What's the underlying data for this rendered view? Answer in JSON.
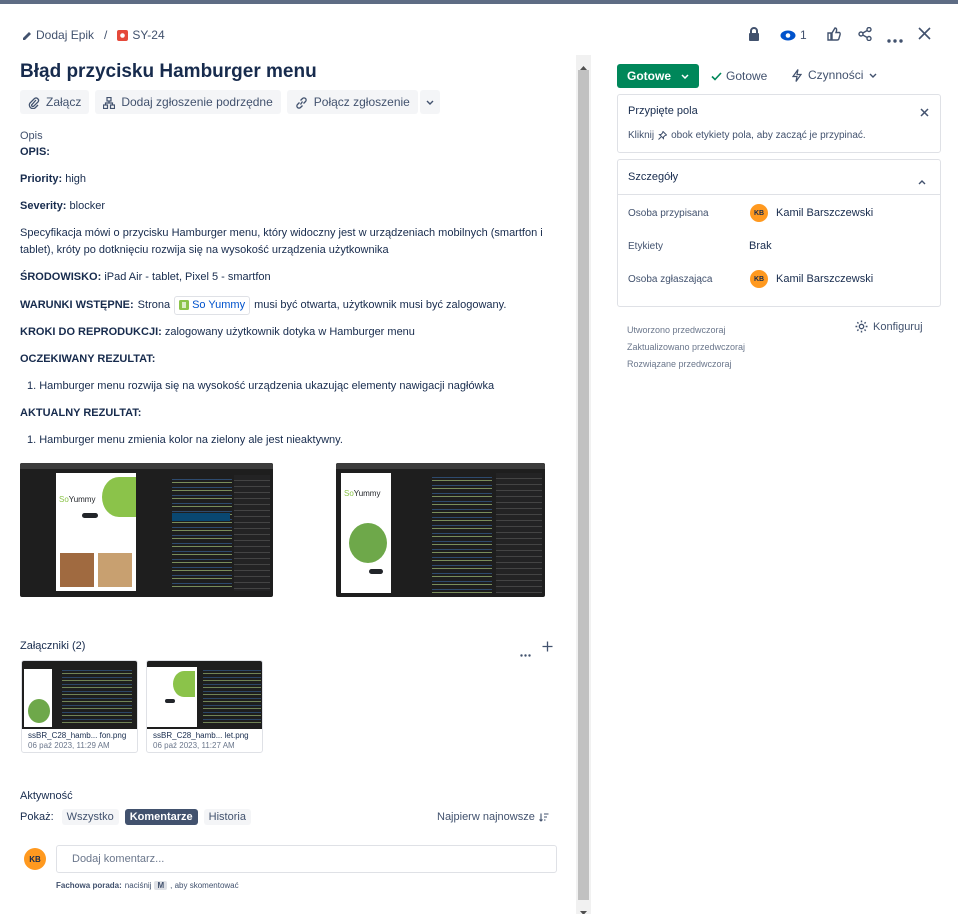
{
  "breadcrumb": {
    "epic_label": "Dodaj Epik",
    "separator": "/",
    "issue_key": "SY-24"
  },
  "header_actions": {
    "watch_count": "1"
  },
  "issue": {
    "title": "Błąd przycisku Hamburger menu"
  },
  "toolbar": {
    "attach": "Załącz",
    "add_child": "Dodaj zgłoszenie podrzędne",
    "link_issue": "Połącz zgłoszenie"
  },
  "description": {
    "label": "Opis",
    "opis": "OPIS:",
    "priority_key": "Priority:",
    "priority_val": "high",
    "severity_key": "Severity:",
    "severity_val": "blocker",
    "spec_line1": " Specyfikacja mówi o przycisku Hamburger menu, który widoczny jest w urządzeniach mobilnych (smartfon i",
    "spec_line2": "tablet), króty po dotknięciu rozwija się na wysokość urządzenia użytkownika",
    "env_key": "ŚRODOWISKO:",
    "env_val": "iPad Air - tablet, Pixel 5 - smartfon",
    "pre_key": "WARUNKI WSTĘPNE:",
    "pre_val1": "Strona",
    "pre_link": "So Yummy",
    "pre_val2": "musi być otwarta, użytkownik musi być zalogowany.",
    "steps_key": "KROKI DO REPRODUKCJI:",
    "steps_val": "zalogowany użytkownik dotyka w Hamburger menu",
    "expected_key": "OCZEKIWANY REZULTAT:",
    "expected_item": "1. Hamburger menu rozwija się na wysokość urządzenia ukazując elementy nawigacji nagłówka",
    "actual_key": "AKTUALNY REZULTAT:",
    "actual_item": "1. Hamburger menu zmienia kolor na zielony ale jest nieaktywny."
  },
  "screenshot_text": {
    "brand_so": "So",
    "brand_yummy": "Yummy"
  },
  "attachments": {
    "title": "Załączniki (2)",
    "items": [
      {
        "name": "ssBR_C28_hamb... fon.png",
        "date": "06 paź 2023, 11:29 AM"
      },
      {
        "name": "ssBR_C28_hamb... let.png",
        "date": "06 paź 2023, 11:27 AM"
      }
    ]
  },
  "activity": {
    "title": "Aktywność",
    "show_label": "Pokaż:",
    "filters": [
      "Wszystko",
      "Komentarze",
      "Historia"
    ],
    "sort": "Najpierw najnowsze",
    "comment_placeholder": "Dodaj komentarz...",
    "tip_bold": "Fachowa porada:",
    "tip_pre": "naciśnij",
    "tip_key": "M",
    "tip_post": ", aby skomentować",
    "avatar": "KB"
  },
  "status": {
    "button": "Gotowe",
    "resolution": "Gotowe",
    "actions": "Czynności"
  },
  "pinned": {
    "title": "Przypięte pola",
    "hint_pre": "Kliknij",
    "hint_post": "obok etykiety pola, aby zacząć je przypinać."
  },
  "details": {
    "title": "Szczegóły",
    "assignee_label": "Osoba przypisana",
    "assignee": "Kamil Barszczewski",
    "assignee_initials": "KB",
    "labels_label": "Etykiety",
    "labels_val": "Brak",
    "reporter_label": "Osoba zgłaszająca",
    "reporter": "Kamil Barszczewski",
    "reporter_initials": "KB"
  },
  "meta": {
    "created": "Utworzono przedwczoraj",
    "updated": "Zaktualizowano przedwczoraj",
    "resolved": "Rozwiązane przedwczoraj",
    "configure": "Konfiguruj"
  },
  "colors": {
    "accent_green": "#00875a",
    "avatar_orange": "#ff991f",
    "text": "#172b4d"
  }
}
